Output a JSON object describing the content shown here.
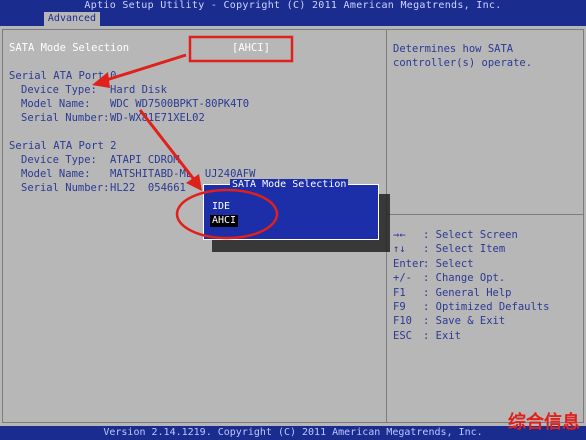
{
  "header": {
    "title": "Aptio Setup Utility - Copyright (C) 2011 American Megatrends, Inc.",
    "tab": "Advanced"
  },
  "sata_mode": {
    "label": "SATA Mode Selection",
    "value": "[AHCI]"
  },
  "port0": {
    "heading": "Serial ATA Port 0",
    "rows": [
      {
        "k": "Device Type:",
        "v": "Hard Disk"
      },
      {
        "k": "Model Name:",
        "v": "WDC WD7500BPKT-80PK4T0"
      },
      {
        "k": "Serial Number:",
        "v": "WD-WX81E71XEL02"
      }
    ]
  },
  "port2": {
    "heading": "Serial ATA Port 2",
    "rows": [
      {
        "k": "Device Type:",
        "v": "ATAPI CDROM"
      },
      {
        "k": "Model Name:",
        "v": "MATSHITABD-ML  UJ240AFW"
      },
      {
        "k": "Serial Number:",
        "v": "HL22  054661"
      }
    ]
  },
  "help": {
    "text": "Determines how SATA controller(s) operate."
  },
  "keys": [
    {
      "key": "→←",
      "desc": ": Select Screen"
    },
    {
      "key": "↑↓",
      "desc": ": Select Item"
    },
    {
      "key": "Enter",
      "desc": ": Select"
    },
    {
      "key": "+/-",
      "desc": ": Change Opt."
    },
    {
      "key": "F1",
      "desc": ": General Help"
    },
    {
      "key": "F9",
      "desc": ": Optimized Defaults"
    },
    {
      "key": "F10",
      "desc": ": Save & Exit"
    },
    {
      "key": "ESC",
      "desc": ": Exit"
    }
  ],
  "dialog": {
    "title": "SATA Mode Selection",
    "options": [
      "IDE",
      "AHCI"
    ]
  },
  "footer": "Version 2.14.1219. Copyright (C) 2011 American Megatrends, Inc.",
  "watermark": "综合信息",
  "colors": {
    "bios_blue": "#1b2c8f",
    "panel_gray": "#b7b7b7",
    "annotation_red": "#e0201b"
  }
}
